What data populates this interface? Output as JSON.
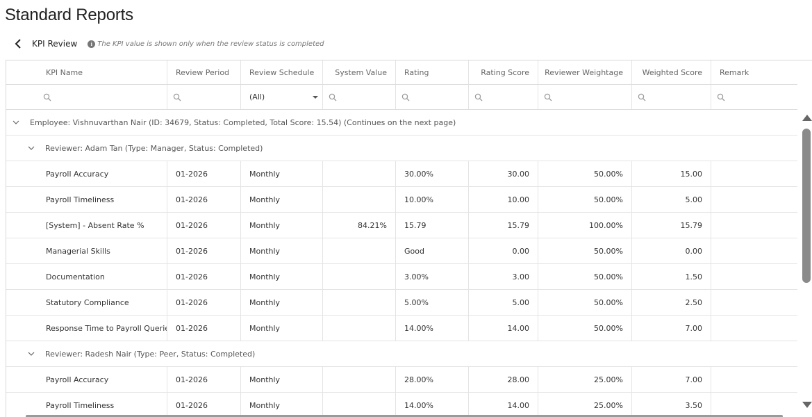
{
  "page": {
    "title": "Standard Reports"
  },
  "subheader": {
    "title": "KPI Review",
    "info_text": "The KPI value is shown only when the review status is completed",
    "info_icon_glyph": "i"
  },
  "columns": {
    "kpi_name": "KPI Name",
    "review_period": "Review Period",
    "review_schedule": "Review Schedule",
    "system_value": "System Value",
    "rating": "Rating",
    "rating_score": "Rating Score",
    "reviewer_weightage": "Reviewer Weightage",
    "weighted_score": "Weighted Score",
    "remark": "Remark"
  },
  "filters": {
    "review_schedule_selected": "(All)"
  },
  "employee_group": "Employee: Vishnuvarthan Nair (ID: 34679, Status: Completed, Total Score: 15.54) (Continues on the next page)",
  "reviewer_groups": [
    {
      "label": "Reviewer: Adam Tan (Type: Manager, Status: Completed)",
      "rows": [
        {
          "kpi": "Payroll Accuracy",
          "period": "01-2026",
          "schedule": "Monthly",
          "system_value": "",
          "rating": "30.00%",
          "rating_score": "30.00",
          "weightage": "50.00%",
          "weighted": "15.00",
          "remark": ""
        },
        {
          "kpi": "Payroll Timeliness",
          "period": "01-2026",
          "schedule": "Monthly",
          "system_value": "",
          "rating": "10.00%",
          "rating_score": "10.00",
          "weightage": "50.00%",
          "weighted": "5.00",
          "remark": ""
        },
        {
          "kpi": "[System] - Absent Rate %",
          "period": "01-2026",
          "schedule": "Monthly",
          "system_value": "84.21%",
          "rating": "15.79",
          "rating_score": "15.79",
          "weightage": "100.00%",
          "weighted": "15.79",
          "remark": ""
        },
        {
          "kpi": "Managerial Skills",
          "period": "01-2026",
          "schedule": "Monthly",
          "system_value": "",
          "rating": "Good",
          "rating_score": "0.00",
          "weightage": "50.00%",
          "weighted": "0.00",
          "remark": ""
        },
        {
          "kpi": "Documentation",
          "period": "01-2026",
          "schedule": "Monthly",
          "system_value": "",
          "rating": "3.00%",
          "rating_score": "3.00",
          "weightage": "50.00%",
          "weighted": "1.50",
          "remark": ""
        },
        {
          "kpi": "Statutory Compliance",
          "period": "01-2026",
          "schedule": "Monthly",
          "system_value": "",
          "rating": "5.00%",
          "rating_score": "5.00",
          "weightage": "50.00%",
          "weighted": "2.50",
          "remark": ""
        },
        {
          "kpi": "Response Time to Payroll Queries",
          "period": "01-2026",
          "schedule": "Monthly",
          "system_value": "",
          "rating": "14.00%",
          "rating_score": "14.00",
          "weightage": "50.00%",
          "weighted": "7.00",
          "remark": ""
        }
      ]
    },
    {
      "label": "Reviewer: Radesh Nair (Type: Peer, Status: Completed)",
      "rows": [
        {
          "kpi": "Payroll Accuracy",
          "period": "01-2026",
          "schedule": "Monthly",
          "system_value": "",
          "rating": "28.00%",
          "rating_score": "28.00",
          "weightage": "25.00%",
          "weighted": "7.00",
          "remark": ""
        },
        {
          "kpi": "Payroll Timeliness",
          "period": "01-2026",
          "schedule": "Monthly",
          "system_value": "",
          "rating": "14.00%",
          "rating_score": "14.00",
          "weightage": "25.00%",
          "weighted": "3.50",
          "remark": ""
        }
      ]
    }
  ],
  "icons": {
    "back": "chevron-left-icon",
    "search": "search-icon",
    "collapse": "chevron-down-icon",
    "dropdown": "caret-down-icon"
  }
}
